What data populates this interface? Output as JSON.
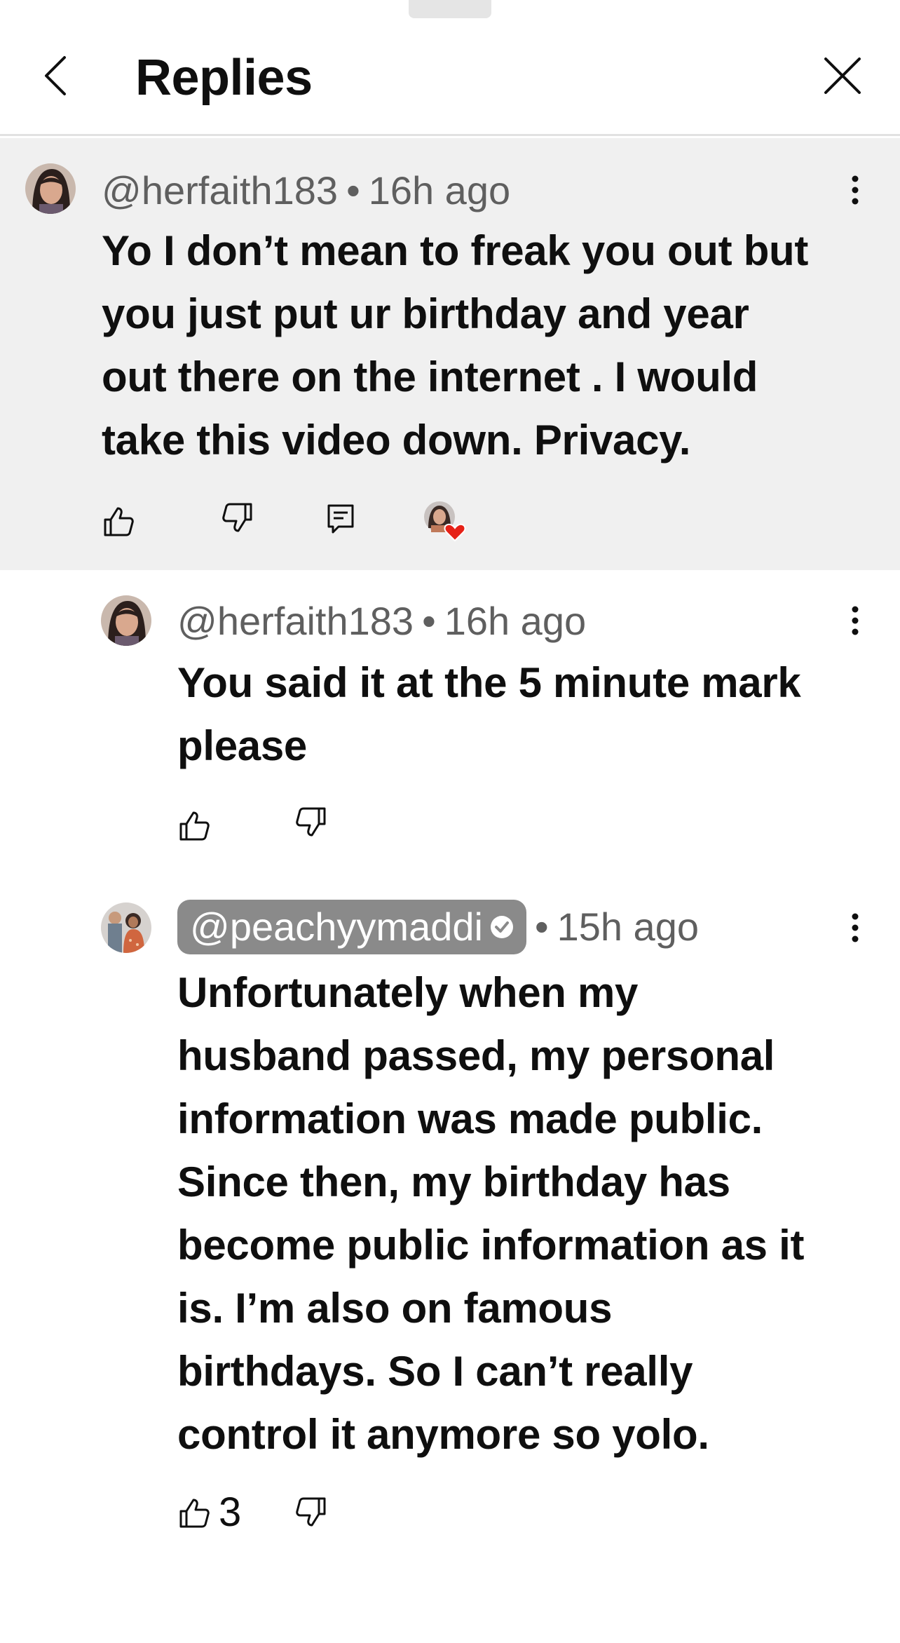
{
  "header": {
    "title": "Replies"
  },
  "comments": [
    {
      "handle": "@herfaith183",
      "separator": "•",
      "time": "16h ago",
      "lines": [
        "Yo I don’t mean to freak you out but",
        "you just put ur birthday and year",
        "out there on the internet . I would",
        "take this video down. Privacy."
      ],
      "highlighted": true,
      "creator_hearted": true
    },
    {
      "handle": "@herfaith183",
      "separator": "•",
      "time": "16h ago",
      "lines": [
        "You said it at the 5 minute mark",
        "please"
      ]
    },
    {
      "handle": "@peachyymaddi",
      "separator": "•",
      "time": "15h ago",
      "verified": true,
      "is_creator": true,
      "lines": [
        "Unfortunately when my",
        "husband passed, my personal",
        "information was made public.",
        "Since then, my birthday has",
        "become public information as it",
        "is. I’m also on famous",
        "birthdays. So I can’t really",
        "control it anymore so yolo."
      ],
      "like_count": "3"
    }
  ],
  "colors": {
    "highlight_bg": "#f0f0f0",
    "meta_text": "#5f5f5f",
    "creator_chip": "#8a8a8a",
    "heart": "#e62117"
  },
  "icons": [
    "back-icon",
    "close-icon",
    "more-vert-icon",
    "thumbs-up-icon",
    "thumbs-down-icon",
    "reply-icon",
    "creator-heart-icon",
    "verified-icon"
  ]
}
